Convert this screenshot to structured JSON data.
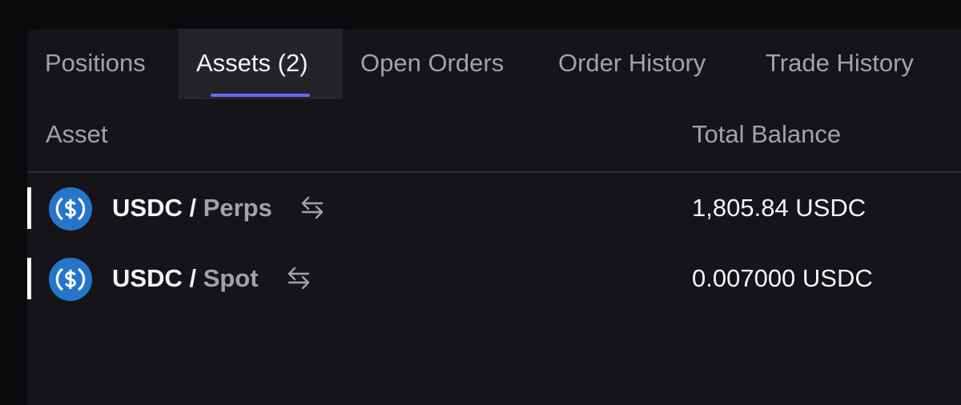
{
  "tabs": [
    {
      "label": "Positions"
    },
    {
      "label": "Assets (2)"
    },
    {
      "label": "Open Orders"
    },
    {
      "label": "Order History"
    },
    {
      "label": "Trade History"
    }
  ],
  "active_tab": "Assets (2)",
  "table": {
    "headers": {
      "asset": "Asset",
      "total_balance": "Total Balance"
    },
    "rows": [
      {
        "coin": "USDC",
        "separator": " / ",
        "account": "Perps",
        "balance": "1,805.84 USDC"
      },
      {
        "coin": "USDC",
        "separator": " / ",
        "account": "Spot",
        "balance": "0.007000 USDC"
      }
    ]
  },
  "colors": {
    "accent": "#5f6ff0",
    "usdc_blue": "#2775ca",
    "panel_bg": "#151419",
    "active_tab_bg": "#24232a"
  },
  "icons": {
    "coin": "usdc-icon",
    "transfer": "swap-arrows-icon"
  }
}
